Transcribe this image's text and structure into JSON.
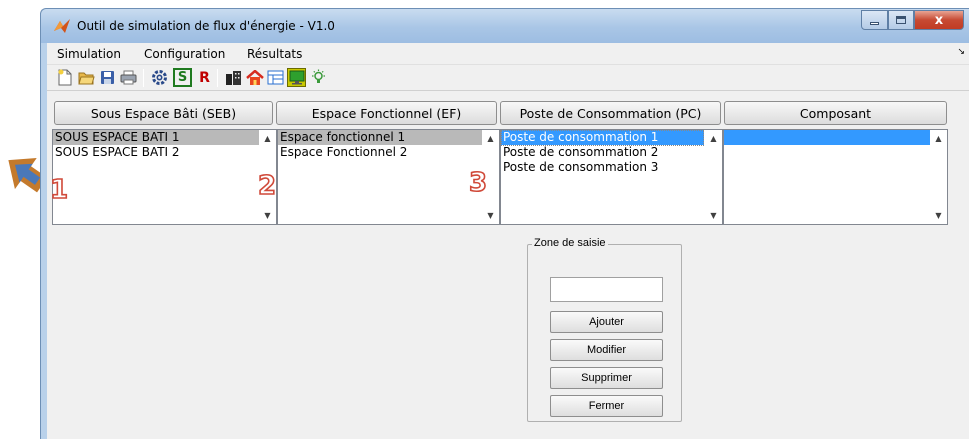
{
  "window": {
    "title": "Outil de simulation de flux d'énergie - V1.0",
    "close_glyph": "x"
  },
  "menu": {
    "items": [
      "Simulation",
      "Configuration",
      "Résultats"
    ],
    "overflow_glyph": "↘"
  },
  "toolbar": {
    "icons": [
      "new-file-icon",
      "open-folder-icon",
      "save-icon",
      "print-icon",
      "gear-icon",
      "simulate-icon",
      "results-icon",
      "building-icon",
      "home-icon",
      "layout-icon",
      "monitor-icon",
      "bulb-icon"
    ],
    "s_label": "S",
    "r_label": "R"
  },
  "columns": {
    "seb": {
      "header": "Sous Espace Bâti (SEB)",
      "items": [
        "SOUS ESPACE BATI 1",
        "SOUS ESPACE BATI 2"
      ],
      "selected_index": 0
    },
    "ef": {
      "header": "Espace Fonctionnel (EF)",
      "items": [
        "Espace fonctionnel 1",
        "Espace Fonctionnel 2"
      ],
      "selected_index": 0
    },
    "pc": {
      "header": "Poste de  Consommation (PC)",
      "items": [
        "Poste de consommation 1",
        "Poste de consommation 2",
        "Poste de consommation 3"
      ],
      "selected_index": 0
    },
    "comp": {
      "header": "Composant",
      "items": [
        ""
      ],
      "selected_index": 0
    }
  },
  "input_zone": {
    "title": "Zone de saisie",
    "value": "",
    "buttons": [
      "Ajouter",
      "Modifier",
      "Supprimer",
      "Fermer"
    ]
  },
  "annotations": {
    "numbers": [
      "1",
      "2",
      "3"
    ],
    "colors": {
      "number": "#d04a3a",
      "arrow": "#c47a2c",
      "arrow_inner": "#4a78b8"
    }
  },
  "colors": {
    "selection_blue": "#3399ff",
    "selection_gray": "#b9b9b9",
    "titlebar": "#a9c6e6",
    "close_button": "#c74a33"
  }
}
